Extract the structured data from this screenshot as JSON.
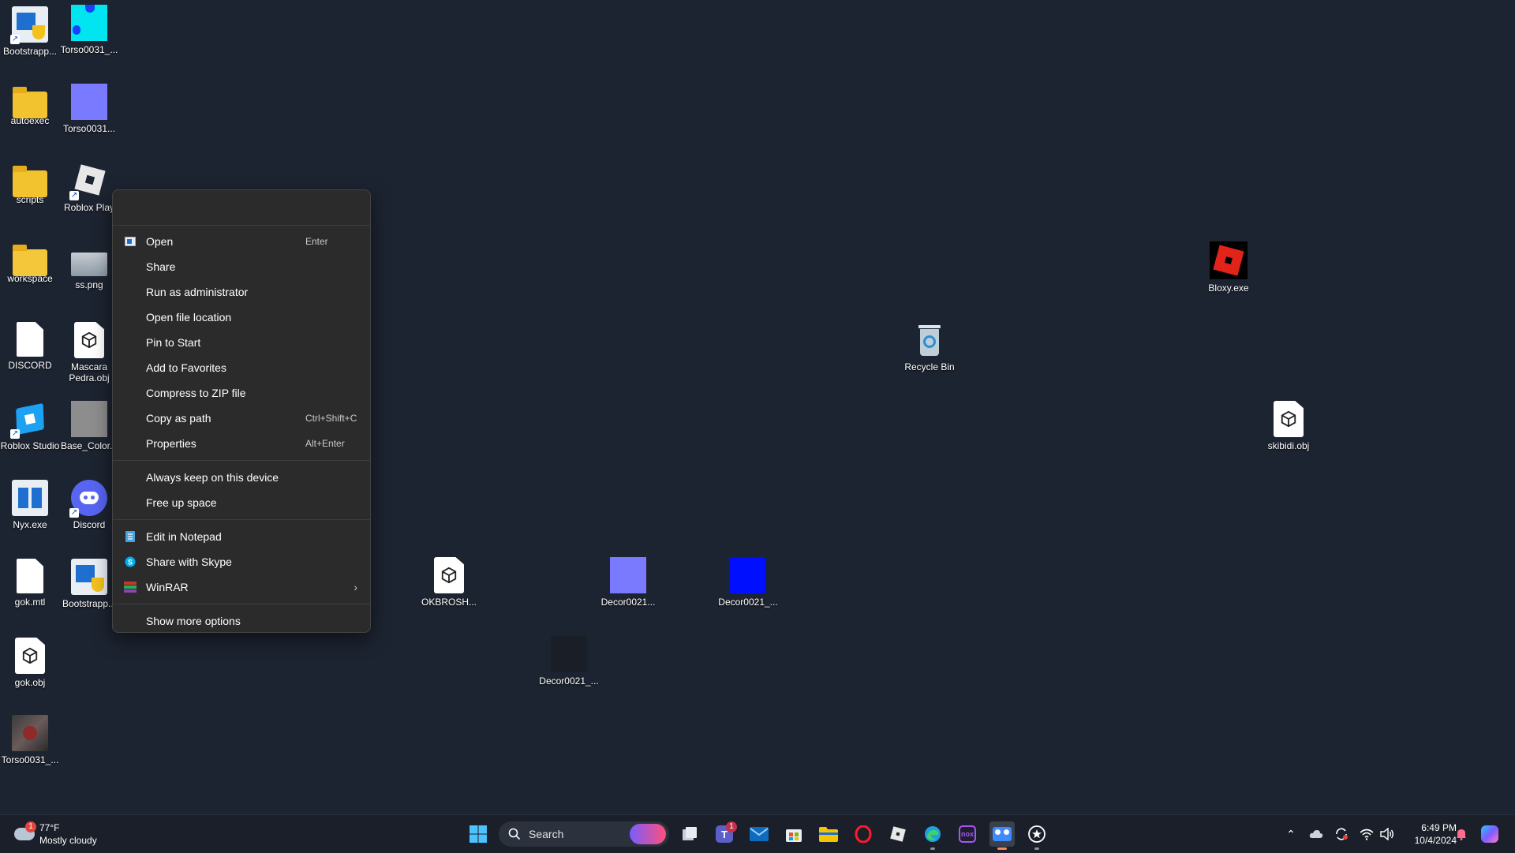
{
  "desktop": {
    "icons": [
      {
        "label": "Bootstrapp..."
      },
      {
        "label": "Torso0031_..."
      },
      {
        "label": "autoexec"
      },
      {
        "label": "Torso0031..."
      },
      {
        "label": "scripts"
      },
      {
        "label": "Roblox Play"
      },
      {
        "label": "workspace"
      },
      {
        "label": "ss.png"
      },
      {
        "label": "DISCORD"
      },
      {
        "label": "Mascara Pedra.obj"
      },
      {
        "label": "Roblox Studio"
      },
      {
        "label": "Base_Color..."
      },
      {
        "label": "Nyx.exe"
      },
      {
        "label": "Discord"
      },
      {
        "label": "gok.mtl"
      },
      {
        "label": "Bootstrapp..."
      },
      {
        "label": "gok.obj"
      },
      {
        "label": "Torso0031_..."
      },
      {
        "label": "OKBROSH..."
      },
      {
        "label": "Decor0021..."
      },
      {
        "label": "Decor0021_..."
      },
      {
        "label": "Decor0021_..."
      },
      {
        "label": "Recycle Bin"
      },
      {
        "label": "Bloxy.exe"
      },
      {
        "label": "skibidi.obj"
      }
    ]
  },
  "context_menu": {
    "items": [
      {
        "label": "Open",
        "shortcut": "Enter"
      },
      {
        "label": "Share"
      },
      {
        "label": "Run as administrator"
      },
      {
        "label": "Open file location"
      },
      {
        "label": "Pin to Start"
      },
      {
        "label": "Add to Favorites"
      },
      {
        "label": "Compress to ZIP file"
      },
      {
        "label": "Copy as path",
        "shortcut": "Ctrl+Shift+C"
      },
      {
        "label": "Properties",
        "shortcut": "Alt+Enter"
      },
      {
        "label": "Always keep on this device"
      },
      {
        "label": "Free up space"
      },
      {
        "label": "Edit in Notepad"
      },
      {
        "label": "Share with Skype"
      },
      {
        "label": "WinRAR"
      },
      {
        "label": "Show more options"
      }
    ]
  },
  "taskbar": {
    "weather": {
      "temp": "77°F",
      "condition": "Mostly cloudy",
      "badge": "1"
    },
    "search_label": "Search",
    "teams_badge": "1",
    "clock": {
      "time": "6:49 PM",
      "date": "10/4/2024"
    }
  },
  "colors": {
    "desktop_bg": "#1d2431",
    "menu_bg": "#2b2b2b",
    "taskbar_bg": "#1a1f29",
    "accent": "#0078d4"
  }
}
